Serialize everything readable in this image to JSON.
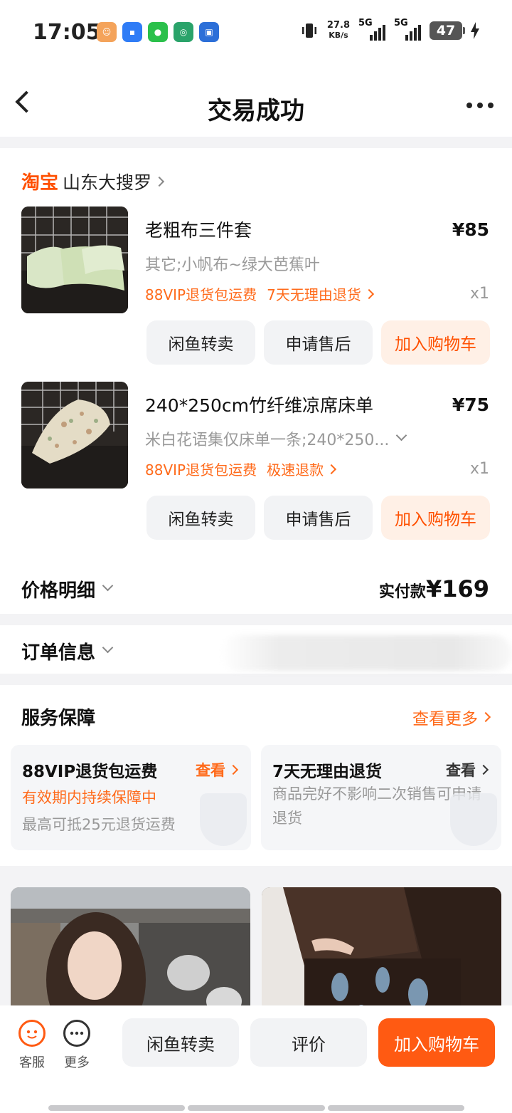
{
  "status_bar": {
    "time": "17:05",
    "net_speed_value": "27.8",
    "net_speed_unit": "KB/s",
    "signal1": "5G",
    "signal2": "5G",
    "battery": "47",
    "app_icons": [
      "notification-app-icon",
      "message-app-icon",
      "wechat-icon",
      "app-icon",
      "calendar-app-icon"
    ]
  },
  "header": {
    "title": "交易成功"
  },
  "order": {
    "platform": "淘宝",
    "store": "山东大搜罗",
    "items": [
      {
        "name": "老粗布三件套",
        "price": "¥85",
        "spec": "其它;小帆布~绿大芭蕉叶",
        "tag1": "88VIP退货包运费",
        "tag2": "7天无理由退货",
        "qty": "x1"
      },
      {
        "name": "240*250cm竹纤维凉席床单",
        "price": "¥75",
        "spec": "米白花语集仅床单一条;240*250...",
        "tag1": "88VIP退货包运费",
        "tag2": "极速退款",
        "qty": "x1"
      }
    ],
    "buttons": {
      "resell": "闲鱼转卖",
      "after_sale": "申请售后",
      "add_cart": "加入购物车"
    },
    "price_detail_label": "价格明细",
    "paid_label": "实付款",
    "paid_value": "¥169"
  },
  "order_info": {
    "label": "订单信息"
  },
  "service": {
    "title": "服务保障",
    "more": "查看更多",
    "boxes": [
      {
        "title": "88VIP退货包运费",
        "view": "查看",
        "line1": "有效期内持续保障中",
        "line2": "最高可抵25元退货运费"
      },
      {
        "title": "7天无理由退货",
        "view": "查看",
        "desc": "商品完好不影响二次销售可申请退货"
      }
    ]
  },
  "bottom_bar": {
    "service": "客服",
    "more": "更多",
    "resell": "闲鱼转卖",
    "review": "评价",
    "add_cart": "加入购物车"
  },
  "colors": {
    "accent": "#ff5000",
    "accent_light": "#fff0e6",
    "tag": "#ff6a1a",
    "gray_text": "#999999"
  }
}
